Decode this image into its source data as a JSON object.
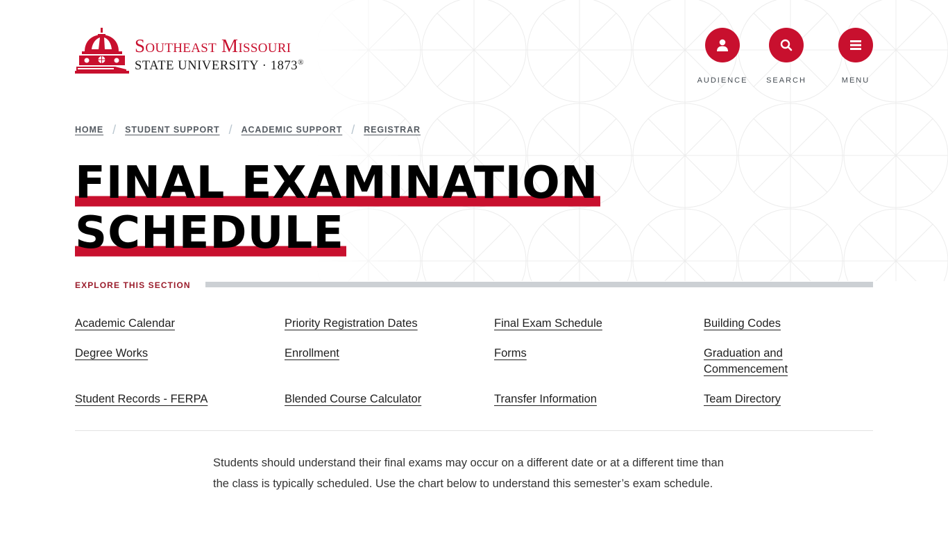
{
  "brand": {
    "name_line1": "Southeast Missouri",
    "name_line2": "STATE UNIVERSITY · 1873",
    "registered_mark": "®",
    "accent_color": "#c8102e"
  },
  "utility_nav": [
    {
      "label": "AUDIENCE",
      "icon": "person-icon"
    },
    {
      "label": "SEARCH",
      "icon": "search-icon"
    },
    {
      "label": "MENU",
      "icon": "hamburger-menu-icon"
    }
  ],
  "breadcrumb": [
    {
      "label": "HOME"
    },
    {
      "label": "STUDENT SUPPORT"
    },
    {
      "label": "ACADEMIC SUPPORT"
    },
    {
      "label": "REGISTRAR"
    }
  ],
  "page": {
    "title_line1": "FINAL EXAMINATION",
    "title_line2": "SCHEDULE"
  },
  "explore": {
    "label": "EXPLORE THIS SECTION",
    "links": [
      "Academic Calendar",
      "Priority Registration Dates",
      "Final Exam Schedule",
      "Building Codes",
      "Degree Works",
      "Enrollment",
      "Forms",
      "Graduation and Commencement",
      "Student Records - FERPA",
      "Blended Course Calculator",
      "Transfer Information",
      "Team Directory"
    ]
  },
  "intro_text": "Students should understand their final exams may occur on a different date or at a different time than the class is typically scheduled. Use the chart below to understand this semester’s exam schedule."
}
